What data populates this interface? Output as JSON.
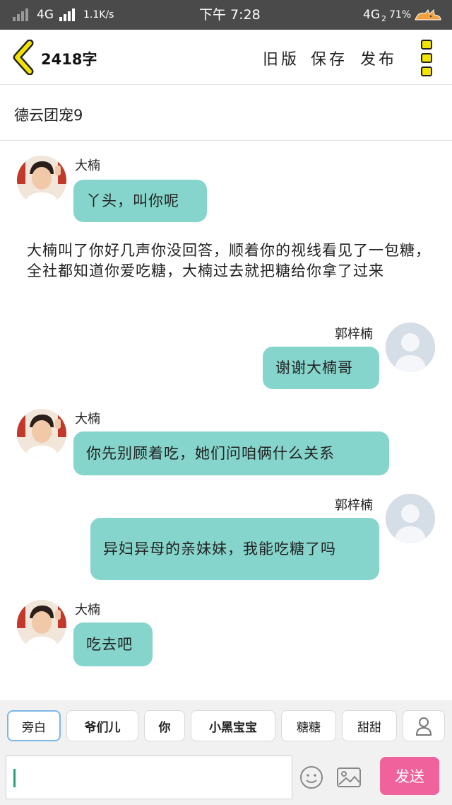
{
  "status_bar": {
    "network_left": "4G",
    "speed": "1.1K/s",
    "time": "下午 7:28",
    "network_right": "4G",
    "network_right_sub": "2",
    "battery": "71%"
  },
  "header": {
    "word_count": "2418字",
    "actions": [
      "旧版",
      "保存",
      "发布"
    ]
  },
  "story_title": "德云团宠9",
  "messages": [
    {
      "side": "left",
      "name": "大楠",
      "text": "丫头，叫你呢"
    },
    {
      "side": "right",
      "name": "郭梓楠",
      "text": "谢谢大楠哥"
    },
    {
      "side": "left",
      "name": "大楠",
      "text": "你先别顾着吃，她们问咱俩什么关系"
    },
    {
      "side": "right",
      "name": "郭梓楠",
      "text": "异妇异母的亲妹妹，我能吃糖了吗"
    },
    {
      "side": "left",
      "name": "大楠",
      "text": "吃去吧"
    }
  ],
  "narration": "大楠叫了你好几声你没回答，顺着你的视线看见了一包糖，全社都知道你爱吃糖，大楠过去就把糖给你拿了过来",
  "roles": [
    "旁白",
    "爷们儿",
    "你",
    "小黑宝宝",
    "糖糖",
    "甜甜"
  ],
  "input": {
    "value": "",
    "send_label": "发送"
  },
  "colors": {
    "bubble": "#86d5cc",
    "send": "#f0629c",
    "back_arrow": "#f3e400"
  }
}
